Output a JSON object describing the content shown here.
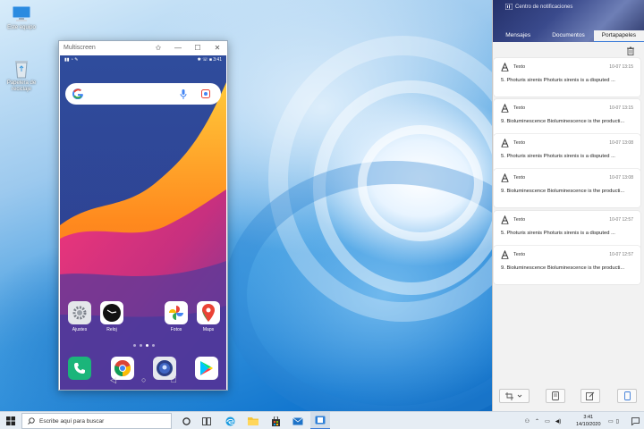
{
  "desktop": {
    "icons": [
      {
        "name": "this-pc-icon",
        "label": "Este equipo"
      },
      {
        "name": "recycle-bin-icon",
        "label": "Papelera de reciclaje"
      }
    ]
  },
  "phone_window": {
    "title": "Multiscreen",
    "status_time": "3:41",
    "status_battery": "■",
    "apps_row1": [
      {
        "label": "Ajustes",
        "icon": "settings-icon"
      },
      {
        "label": "Reloj",
        "icon": "clock-icon"
      },
      {
        "label": "Fotos",
        "icon": "photos-icon"
      },
      {
        "label": "Maps",
        "icon": "maps-icon"
      }
    ],
    "dock": [
      {
        "icon": "phone-icon"
      },
      {
        "icon": "chrome-icon"
      },
      {
        "icon": "contacts-icon"
      },
      {
        "icon": "play-store-icon"
      }
    ]
  },
  "notifications": {
    "title": "Centro de notificaciones",
    "tabs": [
      "Mensajes",
      "Documentos",
      "Portapapeles"
    ],
    "active_tab": "Portapapeles",
    "cards": [
      {
        "type": "Texto",
        "time": "10-07 13:15",
        "text": "5. Photuris sirenis Photuris sirenis is a disputed ..."
      },
      {
        "type": "Texto",
        "time": "10-07 13:15",
        "text": "9. Bioluminescence Bioluminescence is the producti..."
      },
      {
        "type": "Texto",
        "time": "10-07 13:08",
        "text": "5. Photuris sirenis Photuris sirenis is a disputed ..."
      },
      {
        "type": "Texto",
        "time": "10-07 13:08",
        "text": "9. Bioluminescence Bioluminescence is the producti..."
      },
      {
        "type": "Texto",
        "time": "10-07 12:57",
        "text": "5. Photuris sirenis Photuris sirenis is a disputed ..."
      },
      {
        "type": "Texto",
        "time": "10-07 12:57",
        "text": "9. Bioluminescence Bioluminescence is the producti..."
      }
    ]
  },
  "taskbar": {
    "search_placeholder": "Escribe aquí para buscar",
    "time": "3:41",
    "date": "14/10/2020"
  },
  "colors": {
    "accent": "#0a63c9",
    "tab_active_underline": "#3b7bd8"
  }
}
